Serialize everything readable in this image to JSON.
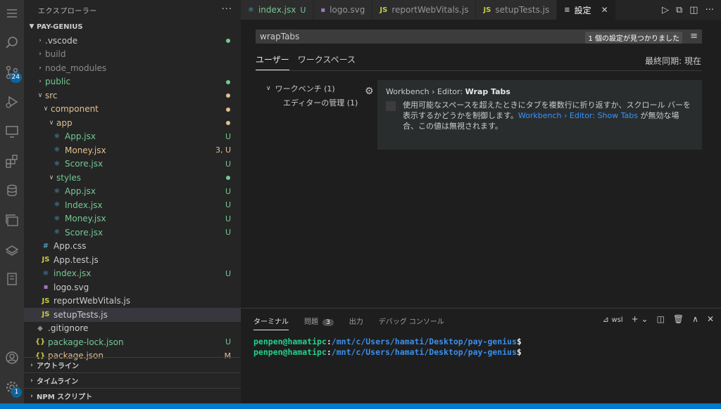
{
  "sidebar": {
    "title": "エクスプローラー",
    "more": "···",
    "root": "PAY-GENIUS",
    "items": [
      {
        "label": ".vscode",
        "indent": 1,
        "type": "folder",
        "open": false,
        "status": "",
        "dot": "untracked"
      },
      {
        "label": "build",
        "indent": 1,
        "type": "folder",
        "open": false,
        "status": "",
        "dot": "",
        "color": "ignore"
      },
      {
        "label": "node_modules",
        "indent": 1,
        "type": "folder",
        "open": false,
        "status": "",
        "dot": "",
        "color": "ignore"
      },
      {
        "label": "public",
        "indent": 1,
        "type": "folder",
        "open": false,
        "status": "",
        "dot": "untracked",
        "color": "untracked"
      },
      {
        "label": "src",
        "indent": 1,
        "type": "folder",
        "open": true,
        "status": "",
        "dot": "mod",
        "color": "mod"
      },
      {
        "label": "component",
        "indent": 2,
        "type": "folder",
        "open": true,
        "status": "",
        "dot": "mod",
        "color": "mod"
      },
      {
        "label": "app",
        "indent": 3,
        "type": "folder",
        "open": true,
        "status": "",
        "dot": "mod",
        "color": "mod"
      },
      {
        "label": "App.jsx",
        "indent": 4,
        "type": "react",
        "status": "U",
        "color": "untracked"
      },
      {
        "label": "Money.jsx",
        "indent": 4,
        "type": "react",
        "status": "3, U",
        "color": "mod"
      },
      {
        "label": "Score.jsx",
        "indent": 4,
        "type": "react",
        "status": "U",
        "color": "untracked"
      },
      {
        "label": "styles",
        "indent": 3,
        "type": "folder",
        "open": true,
        "status": "",
        "dot": "untracked",
        "color": "untracked"
      },
      {
        "label": "App.jsx",
        "indent": 4,
        "type": "react",
        "status": "U",
        "color": "untracked"
      },
      {
        "label": "Index.jsx",
        "indent": 4,
        "type": "react",
        "status": "U",
        "color": "untracked"
      },
      {
        "label": "Money.jsx",
        "indent": 4,
        "type": "react",
        "status": "U",
        "color": "untracked"
      },
      {
        "label": "Score.jsx",
        "indent": 4,
        "type": "react",
        "status": "U",
        "color": "untracked"
      },
      {
        "label": "App.css",
        "indent": 2,
        "type": "css",
        "status": "",
        "color": "white"
      },
      {
        "label": "App.test.js",
        "indent": 2,
        "type": "js",
        "status": "",
        "color": "white"
      },
      {
        "label": "index.jsx",
        "indent": 2,
        "type": "react",
        "status": "U",
        "color": "untracked"
      },
      {
        "label": "logo.svg",
        "indent": 2,
        "type": "svg",
        "status": "",
        "color": "white"
      },
      {
        "label": "reportWebVitals.js",
        "indent": 2,
        "type": "js",
        "status": "",
        "color": "white"
      },
      {
        "label": "setupTests.js",
        "indent": 2,
        "type": "js",
        "status": "",
        "color": "white",
        "selected": true
      },
      {
        "label": ".gitignore",
        "indent": 1,
        "type": "git",
        "status": "",
        "color": "white"
      },
      {
        "label": "package-lock.json",
        "indent": 1,
        "type": "json",
        "status": "U",
        "color": "untracked"
      },
      {
        "label": "package.json",
        "indent": 1,
        "type": "json",
        "status": "M",
        "color": "mod"
      }
    ],
    "bottom_sections": [
      "アウトライン",
      "タイムライン",
      "NPM スクリプト"
    ]
  },
  "activity": {
    "scm_badge": "24",
    "settings_badge": "1"
  },
  "tabs": [
    {
      "label": "index.jsx",
      "icon": "react",
      "status": "U"
    },
    {
      "label": "logo.svg",
      "icon": "svg",
      "status": ""
    },
    {
      "label": "reportWebVitals.js",
      "icon": "js",
      "status": ""
    },
    {
      "label": "setupTests.js",
      "icon": "js",
      "status": ""
    },
    {
      "label": "設定",
      "icon": "settings",
      "status": "",
      "active": true
    }
  ],
  "settings": {
    "search_value": "wrapTabs",
    "found": "1 個の設定が見つかりました",
    "tab_user": "ユーザー",
    "tab_workspace": "ワークスペース",
    "last_sync": "最終同期: 現在",
    "toc_workbench": "ワークベンチ (1)",
    "toc_editor": "エディターの管理 (1)",
    "setting_prefix": "Workbench › Editor: ",
    "setting_name": "Wrap Tabs",
    "desc_1": "使用可能なスペースを超えたときにタブを複数行に折り返すか、スクロール バーを表示するかどうかを制御します。",
    "desc_link": "Workbench › Editor: Show Tabs",
    "desc_2": " が無効な場合、この値は無視されます。",
    "checked": false
  },
  "panel": {
    "tabs": [
      "ターミナル",
      "問題",
      "出力",
      "デバッグ コンソール"
    ],
    "problems_count": "3",
    "shell": "wsl",
    "lines": [
      {
        "user": "penpen@hamatipc",
        "sep": ":",
        "path": "/mnt/c/Users/hamati/Desktop/pay-genius",
        "prompt": "$"
      },
      {
        "user": "penpen@hamatipc",
        "sep": ":",
        "path": "/mnt/c/Users/hamati/Desktop/pay-genius",
        "prompt": "$"
      }
    ]
  },
  "colors": {
    "accent": "#007acc",
    "untracked": "#73c991",
    "modified": "#e2c08d"
  }
}
